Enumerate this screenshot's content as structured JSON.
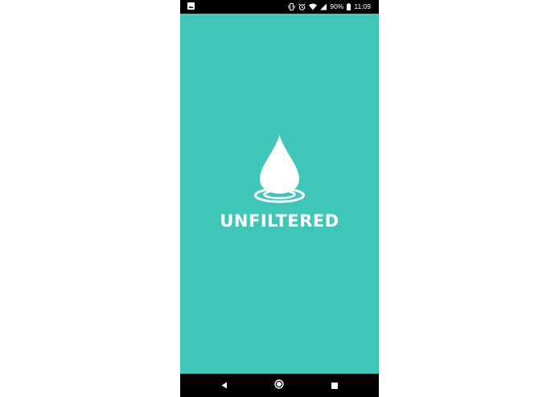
{
  "status_bar": {
    "battery_percent": "90%",
    "time": "11:09",
    "icons": [
      "image-notification-icon",
      "vibrate-icon",
      "alarm-icon",
      "wifi-icon",
      "signal-icon",
      "battery-icon"
    ]
  },
  "splash": {
    "app_name": "UNFILTERED",
    "logo_icon": "water-drop-icon",
    "background_color": "#3fc6b9"
  },
  "nav_bar": {
    "buttons": [
      "back-icon",
      "home-icon",
      "recents-icon"
    ]
  }
}
